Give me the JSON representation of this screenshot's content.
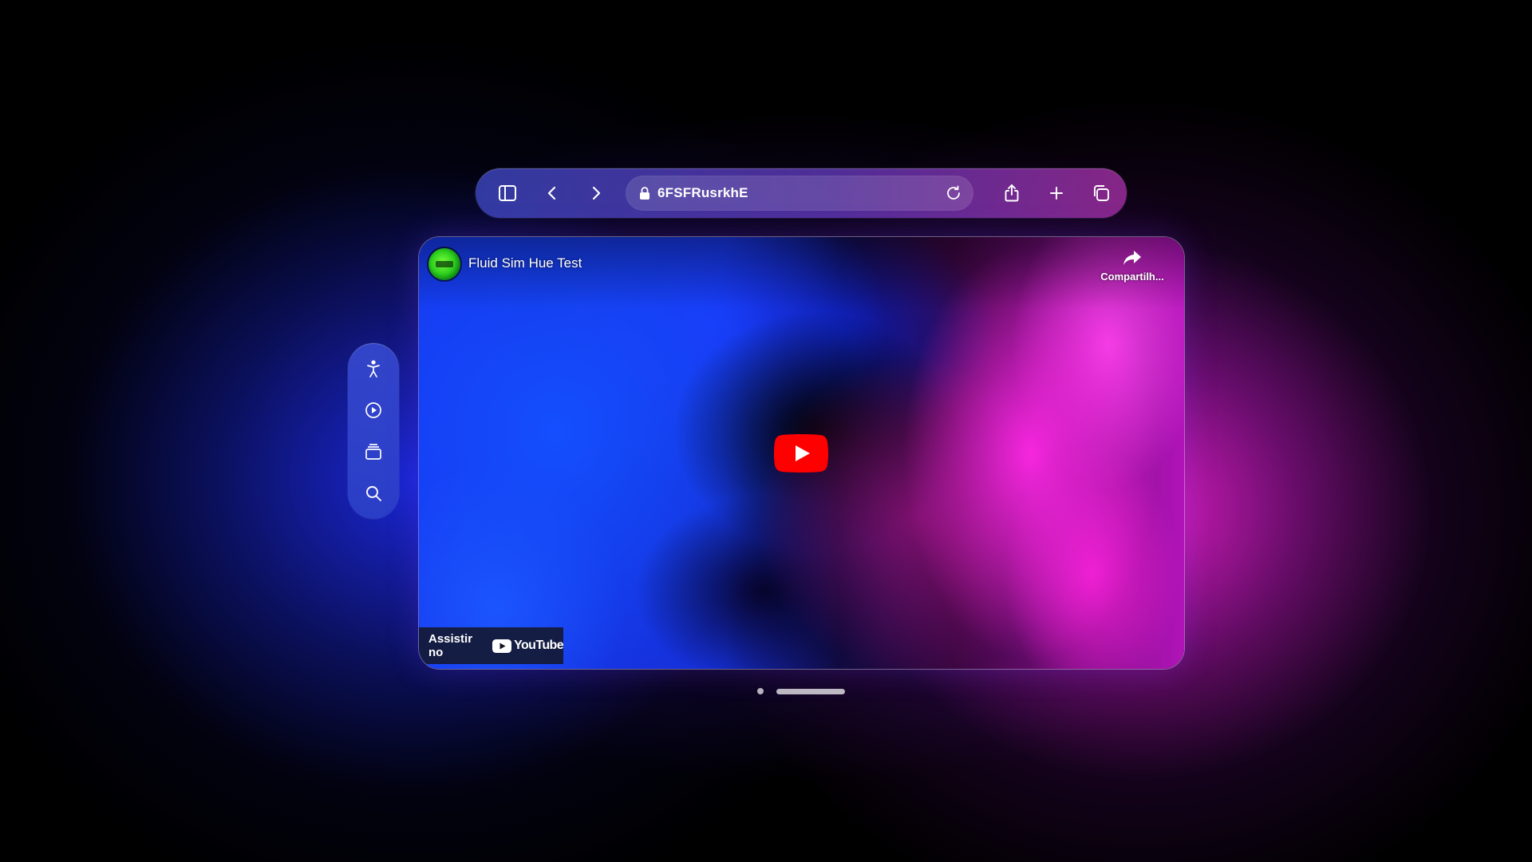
{
  "browser": {
    "url": "6FSFRusrkhE",
    "toolbar_icons": [
      "sidebar-toggle-icon",
      "chevron-left-icon",
      "chevron-right-icon",
      "lock-icon",
      "reload-icon",
      "share-icon",
      "plus-icon",
      "tabs-icon"
    ]
  },
  "sidebar": {
    "icons": [
      "accessibility-icon",
      "play-circle-icon",
      "stack-icon",
      "search-icon"
    ]
  },
  "video": {
    "title": "Fluid Sim Hue Test",
    "share_label": "Compartilh...",
    "watch_on_label": "Assistir no",
    "logo_text": "YouTube",
    "play_icon": "youtube-play-icon"
  },
  "colors": {
    "youtube_red": "#ff0000",
    "glow_blue": "#1e3cff",
    "glow_magenta": "#e61ec8"
  }
}
